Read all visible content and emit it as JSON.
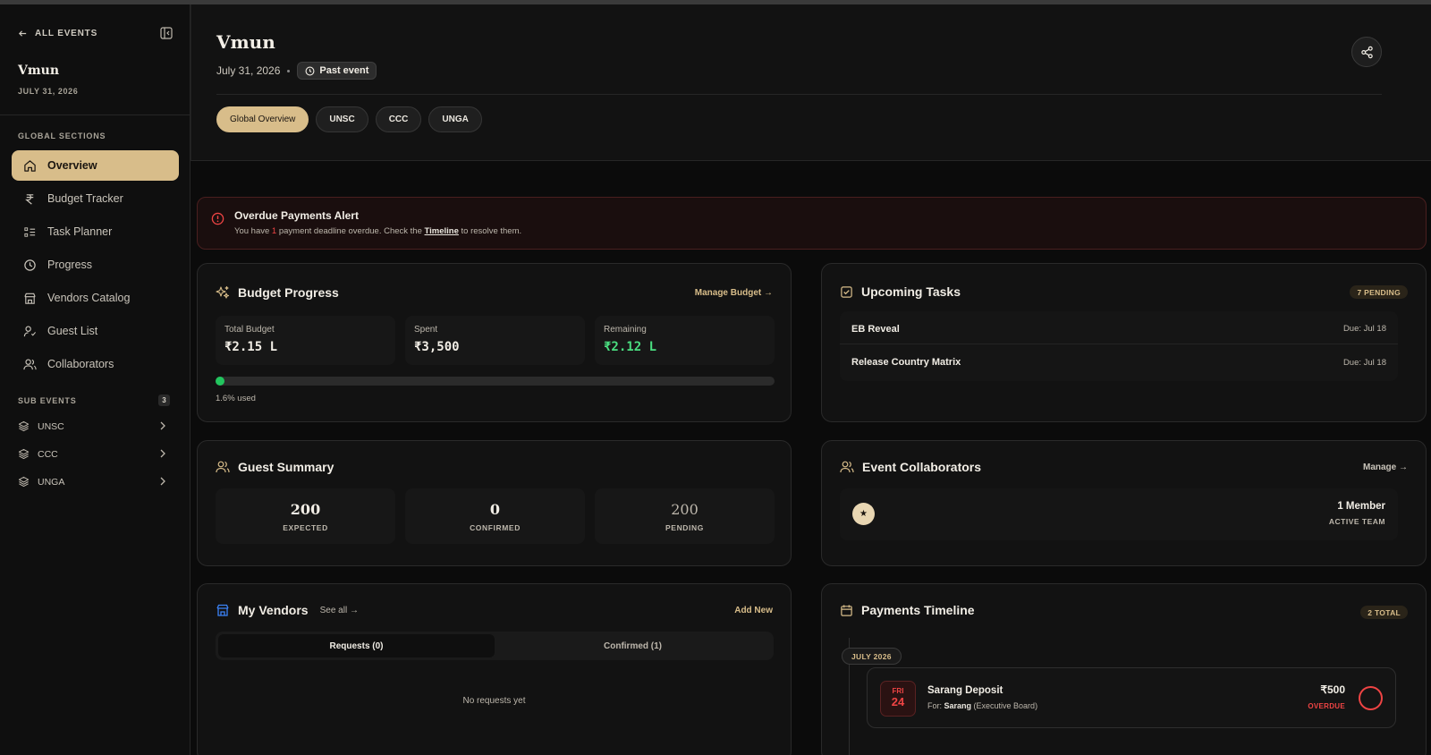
{
  "sidebar": {
    "back_label": "ALL EVENTS",
    "event_title": "Vmun",
    "event_date": "JULY 31, 2026",
    "global_label": "GLOBAL SECTIONS",
    "nav": [
      {
        "label": "Overview",
        "icon": "home-icon"
      },
      {
        "label": "Budget Tracker",
        "icon": "rupee-icon"
      },
      {
        "label": "Task Planner",
        "icon": "checklist-icon"
      },
      {
        "label": "Progress",
        "icon": "clock-icon"
      },
      {
        "label": "Vendors Catalog",
        "icon": "store-icon"
      },
      {
        "label": "Guest List",
        "icon": "user-check-icon"
      },
      {
        "label": "Collaborators",
        "icon": "users-icon"
      }
    ],
    "sub_label": "SUB EVENTS",
    "sub_count": "3",
    "subs": [
      {
        "label": "UNSC"
      },
      {
        "label": "CCC"
      },
      {
        "label": "UNGA"
      }
    ]
  },
  "header": {
    "title": "Vmun",
    "date": "July 31, 2026",
    "status": "Past event",
    "tabs": [
      "Global Overview",
      "UNSC",
      "CCC",
      "UNGA"
    ]
  },
  "alert": {
    "title": "Overdue Payments Alert",
    "body_pre": "You have ",
    "count": "1",
    "body_mid": " payment deadline overdue. Check the ",
    "link": "Timeline",
    "body_post": " to resolve them."
  },
  "budget": {
    "title": "Budget Progress",
    "action": "Manage Budget →",
    "total_label": "Total Budget",
    "total": "₹2.15 L",
    "spent_label": "Spent",
    "spent": "₹3,500",
    "remaining_label": "Remaining",
    "remaining": "₹2.12 L",
    "used_fraction": 0.016,
    "used_label": "1.6% used"
  },
  "tasks": {
    "title": "Upcoming Tasks",
    "badge": "7 PENDING",
    "items": [
      {
        "name": "EB Reveal",
        "due": "Due: Jul 18"
      },
      {
        "name": "Release Country Matrix",
        "due": "Due: Jul 18"
      }
    ]
  },
  "guests": {
    "title": "Guest Summary",
    "expected": "200",
    "expected_label": "EXPECTED",
    "confirmed": "0",
    "confirmed_label": "CONFIRMED",
    "pending": "200",
    "pending_label": "PENDING"
  },
  "collaborators": {
    "title": "Event Collaborators",
    "action": "Manage →",
    "avatar": "★",
    "count": "1 Member",
    "sub": "ACTIVE TEAM"
  },
  "vendors": {
    "title": "My Vendors",
    "see_all": "See all →",
    "action": "Add New",
    "tab_requests": "Requests (0)",
    "tab_confirmed": "Confirmed (1)",
    "empty": "No requests yet"
  },
  "payments": {
    "title": "Payments Timeline",
    "badge": "2 TOTAL",
    "month": "JULY 2026",
    "item": {
      "day": "FRI",
      "date": "24",
      "title": "Sarang Deposit",
      "for_label": "For: ",
      "for_name": "Sarang",
      "for_role": " (Executive Board)",
      "amount": "₹500",
      "status": "OVERDUE"
    }
  },
  "colors": {
    "accent": "#d8bd8a",
    "danger": "#ef4444",
    "success": "#22c55e"
  }
}
